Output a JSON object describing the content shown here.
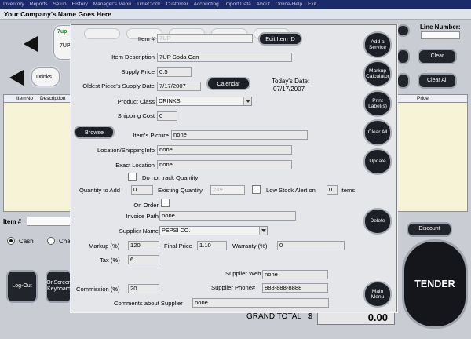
{
  "menu": [
    "Inventory",
    "Reports",
    "Setup",
    "History",
    "Manager's Menu",
    "TimeClock",
    "Customer",
    "Accounting",
    "Import Data",
    "About",
    "Online-Help",
    "Exit"
  ],
  "company_name": "Your Company's Name Goes Here",
  "background": {
    "tile_7up_label": "7UP",
    "tile_drinks_label": "Drinks",
    "line_number_label": "Line Number:",
    "clear_label": "Clear",
    "clear_all_label": "Clear All",
    "grid_headers": {
      "item_no": "ItemNo",
      "description": "Description",
      "price": "Price"
    },
    "item_number_label": "Item #",
    "cash_label": "Cash",
    "charge_label": "Char",
    "discount_label": "Discount",
    "logout_label": "Log-Out",
    "onscreen_keyboard_label": "OnScreen Keyboard",
    "tender_label": "TENDER",
    "grand_total_label": "GRAND TOTAL",
    "grand_total_currency": "$",
    "grand_total_value": "0.00"
  },
  "form": {
    "item_no": {
      "label": "Item #",
      "value": "7UP"
    },
    "edit_item_id_label": "Edit Item ID",
    "description": {
      "label": "Item Description",
      "value": "7UP Soda Can"
    },
    "supply_price": {
      "label": "Supply Price",
      "value": "0.5"
    },
    "supply_date": {
      "label": "Oldest Piece's Supply Date",
      "value": "7/17/2007"
    },
    "calendar_label": "Calendar",
    "todays_date_label": "Today's Date:",
    "todays_date_value": "07/17/2007",
    "product_class": {
      "label": "Product Class",
      "value": "DRINKS"
    },
    "shipping_cost": {
      "label": "Shipping Cost",
      "value": "0"
    },
    "browse_label": "Browse",
    "picture": {
      "label": "Item's Picture",
      "value": "none"
    },
    "location": {
      "label": "Location/ShippingInfo",
      "value": "none"
    },
    "exact_location": {
      "label": "Exact Location",
      "value": "none"
    },
    "no_track_label": "Do not track Quantity",
    "qty_add": {
      "label": "Quantity to Add",
      "value": "0"
    },
    "existing_qty": {
      "label": "Existing Quantity",
      "value": "249"
    },
    "low_stock": {
      "label": "Low Stock Alert on",
      "value": "0",
      "suffix": "items"
    },
    "on_order_label": "On Order",
    "invoice_path": {
      "label": "Invoice Path",
      "value": "none"
    },
    "supplier_name": {
      "label": "Supplier Name",
      "value": "PEPSI CO."
    },
    "markup": {
      "label": "Markup (%)",
      "value": "120"
    },
    "final_price": {
      "label": "Final Price",
      "value": "1.10"
    },
    "warranty": {
      "label": "Warranty (%)",
      "value": "0"
    },
    "tax": {
      "label": "Tax (%)",
      "value": "6"
    },
    "supplier_web": {
      "label": "Supplier Web",
      "value": "none"
    },
    "commission": {
      "label": "Commission (%)",
      "value": "20"
    },
    "supplier_phone": {
      "label": "Supplier Phone#",
      "value": "888-888-8888"
    },
    "comments": {
      "label": "Comments about Supplier",
      "value": "none"
    }
  },
  "side_buttons": {
    "add_service": "Add a Service",
    "markup_calculator": "Markup Calculator",
    "print_labels": "Print Label(s)",
    "clear_all": "Clear All",
    "update": "Update",
    "delete": "Delete",
    "main_menu": "Main Menu"
  }
}
